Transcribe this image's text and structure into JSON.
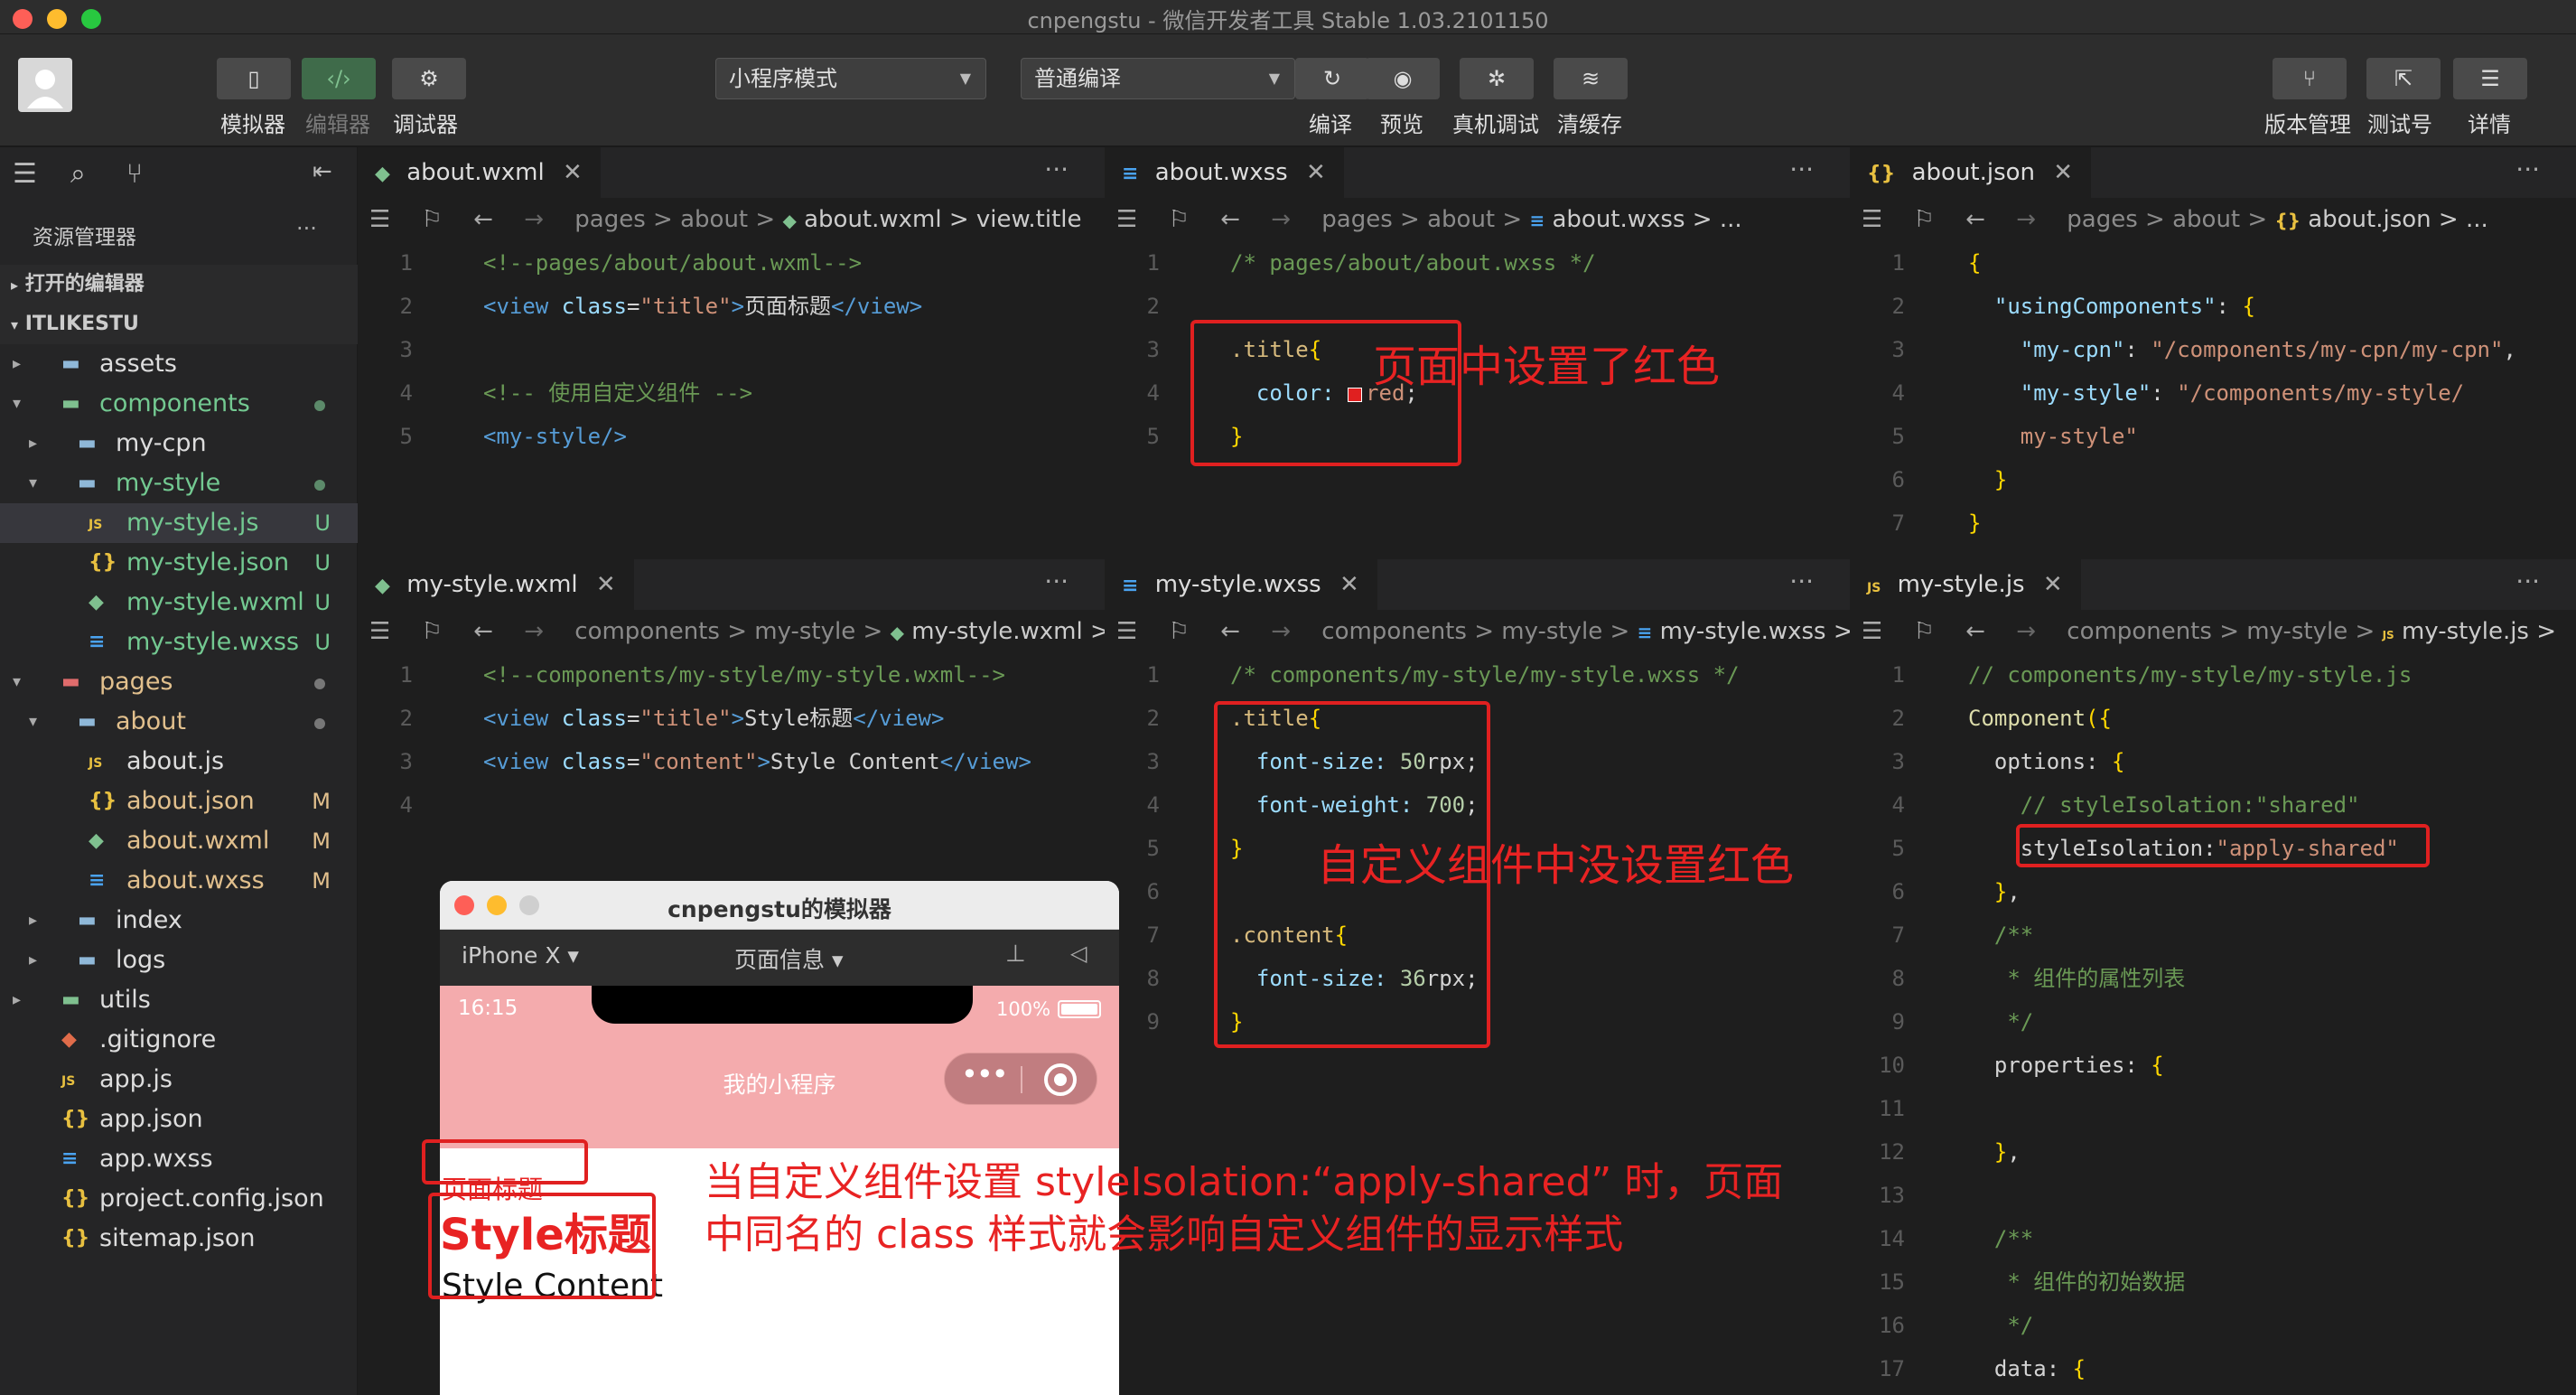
{
  "window": {
    "title": "cnpengstu - 微信开发者工具 Stable 1.03.2101150"
  },
  "toolbar": {
    "left": [
      {
        "label": "模拟器",
        "icon": "phone-icon"
      },
      {
        "label": "编辑器",
        "icon": "code-icon"
      },
      {
        "label": "调试器",
        "icon": "debug-icon"
      }
    ],
    "mode_select": "小程序模式",
    "compile_select": "普通编译",
    "center": [
      {
        "label": "编译",
        "icon": "refresh-icon"
      },
      {
        "label": "预览",
        "icon": "eye-icon"
      },
      {
        "label": "真机调试",
        "icon": "bug-icon"
      },
      {
        "label": "清缓存",
        "icon": "layers-icon"
      }
    ],
    "right": [
      {
        "label": "版本管理",
        "icon": "branch-icon"
      },
      {
        "label": "测试号",
        "icon": "share-icon"
      },
      {
        "label": "详情",
        "icon": "menu-icon"
      }
    ]
  },
  "sidebar": {
    "title": "资源管理器",
    "more": "···",
    "sections": [
      {
        "label": "打开的编辑器"
      },
      {
        "label": "ITLIKESTU"
      }
    ],
    "tree": [
      {
        "name": "assets",
        "type": "folder",
        "depth": 1,
        "arrow": "▸"
      },
      {
        "name": "components",
        "type": "folder-green",
        "depth": 1,
        "arrow": "▾",
        "dot": true,
        "color": "#73c991"
      },
      {
        "name": "my-cpn",
        "type": "folder",
        "depth": 2,
        "arrow": "▸"
      },
      {
        "name": "my-style",
        "type": "folder",
        "depth": 2,
        "arrow": "▾",
        "dot": true,
        "color": "#73c991"
      },
      {
        "name": "my-style.js",
        "type": "js",
        "depth": 3,
        "status": "U",
        "color": "#73c991",
        "selected": true
      },
      {
        "name": "my-style.json",
        "type": "json",
        "depth": 3,
        "status": "U",
        "color": "#73c991"
      },
      {
        "name": "my-style.wxml",
        "type": "wxml",
        "depth": 3,
        "status": "U",
        "color": "#73c991"
      },
      {
        "name": "my-style.wxss",
        "type": "wxss",
        "depth": 3,
        "status": "U",
        "color": "#73c991"
      },
      {
        "name": "pages",
        "type": "folder-red",
        "depth": 1,
        "arrow": "▾",
        "dot": true,
        "color": "#e2c08d"
      },
      {
        "name": "about",
        "type": "folder",
        "depth": 2,
        "arrow": "▾",
        "dot": true,
        "color": "#e2c08d"
      },
      {
        "name": "about.js",
        "type": "js",
        "depth": 3
      },
      {
        "name": "about.json",
        "type": "json",
        "depth": 3,
        "status": "M",
        "color": "#e2c08d"
      },
      {
        "name": "about.wxml",
        "type": "wxml",
        "depth": 3,
        "status": "M",
        "color": "#e2c08d"
      },
      {
        "name": "about.wxss",
        "type": "wxss",
        "depth": 3,
        "status": "M",
        "color": "#e2c08d"
      },
      {
        "name": "index",
        "type": "folder",
        "depth": 2,
        "arrow": "▸"
      },
      {
        "name": "logs",
        "type": "folder",
        "depth": 2,
        "arrow": "▸"
      },
      {
        "name": "utils",
        "type": "folder-green",
        "depth": 1,
        "arrow": "▸"
      },
      {
        "name": ".gitignore",
        "type": "git",
        "depth": 1
      },
      {
        "name": "app.js",
        "type": "js",
        "depth": 1
      },
      {
        "name": "app.json",
        "type": "json",
        "depth": 1
      },
      {
        "name": "app.wxss",
        "type": "wxss",
        "depth": 1
      },
      {
        "name": "project.config.json",
        "type": "json",
        "depth": 1
      },
      {
        "name": "sitemap.json",
        "type": "json",
        "depth": 1
      }
    ]
  },
  "panes": [
    {
      "id": "about-wxml",
      "tab": "about.wxml",
      "crumbs": [
        "pages",
        ">",
        "about",
        ">"
      ],
      "crumb_file": "about.wxml",
      "crumb_tail": "> view.title",
      "lines": [
        [
          [
            "cm",
            "<!--pages/about/about.wxml-->"
          ]
        ],
        [
          [
            "tag",
            "<view "
          ],
          [
            "att",
            "class"
          ],
          [
            "punc",
            "="
          ],
          [
            "str",
            "\"title\""
          ],
          [
            "tag",
            ">"
          ],
          [
            "plain",
            "页面标题"
          ],
          [
            "tag",
            "</view>"
          ]
        ],
        [],
        [
          [
            "cm",
            "<!-- 使用自定义组件 -->"
          ]
        ],
        [
          [
            "tag",
            "<my-style/>"
          ]
        ]
      ]
    },
    {
      "id": "about-wxss",
      "tab": "about.wxss",
      "crumbs": [
        "pages",
        ">",
        "about",
        ">"
      ],
      "crumb_file": "about.wxss",
      "crumb_tail": "> ...",
      "lines": [
        [
          [
            "cm",
            "/* pages/about/about.wxss */"
          ]
        ],
        [],
        [
          [
            "sel2",
            ".title"
          ],
          [
            "yel",
            "{"
          ]
        ],
        [
          [
            "prop",
            "  color: "
          ],
          [
            "swatch",
            ""
          ],
          [
            "str",
            "red"
          ],
          [
            "punc",
            ";"
          ]
        ],
        [
          [
            "yel",
            "}"
          ]
        ]
      ]
    },
    {
      "id": "about-json",
      "tab": "about.json",
      "crumbs": [
        "pages",
        ">",
        "about",
        ">"
      ],
      "crumb_file": "about.json",
      "crumb_tail": "> ...",
      "lines": [
        [
          [
            "yel",
            "{"
          ]
        ],
        [
          [
            "att",
            "  \"usingComponents\""
          ],
          [
            "punc",
            ": "
          ],
          [
            "yel",
            "{"
          ]
        ],
        [
          [
            "att",
            "    \"my-cpn\""
          ],
          [
            "punc",
            ": "
          ],
          [
            "str",
            "\"/components/my-cpn/my-cpn\""
          ],
          [
            "punc",
            ","
          ]
        ],
        [
          [
            "att",
            "    \"my-style\""
          ],
          [
            "punc",
            ": "
          ],
          [
            "str",
            "\"/components/my-style/"
          ]
        ],
        [
          [
            "str",
            "    my-style\""
          ]
        ],
        [
          [
            "yel",
            "  }"
          ]
        ],
        [
          [
            "yel",
            "}"
          ]
        ]
      ]
    },
    {
      "id": "my-style-wxml",
      "tab": "my-style.wxml",
      "crumbs": [
        "components",
        ">",
        "my-style",
        ">"
      ],
      "crumb_file": "my-style.wxml",
      "crumb_tail": ">",
      "lines": [
        [
          [
            "cm",
            "<!--components/my-style/my-style.wxml-->"
          ]
        ],
        [
          [
            "tag",
            "<view "
          ],
          [
            "att",
            "class"
          ],
          [
            "punc",
            "="
          ],
          [
            "str",
            "\"title\""
          ],
          [
            "tag",
            ">"
          ],
          [
            "plain",
            "Style标题"
          ],
          [
            "tag",
            "</view>"
          ]
        ],
        [
          [
            "tag",
            "<view "
          ],
          [
            "att",
            "class"
          ],
          [
            "punc",
            "="
          ],
          [
            "str",
            "\"content\""
          ],
          [
            "tag",
            ">"
          ],
          [
            "plain",
            "Style Content"
          ],
          [
            "tag",
            "</view>"
          ]
        ],
        []
      ]
    },
    {
      "id": "my-style-wxss",
      "tab": "my-style.wxss",
      "crumbs": [
        "components",
        ">",
        "my-style",
        ">"
      ],
      "crumb_file": "my-style.wxss",
      "crumb_tail": ">",
      "lines": [
        [
          [
            "cm",
            "/* components/my-style/my-style.wxss */"
          ]
        ],
        [
          [
            "sel2",
            ".title"
          ],
          [
            "yel",
            "{"
          ]
        ],
        [
          [
            "prop",
            "  font-size: "
          ],
          [
            "val",
            "50"
          ],
          [
            "plain",
            "rpx"
          ],
          [
            "punc",
            ";"
          ]
        ],
        [
          [
            "prop",
            "  font-weight: "
          ],
          [
            "val",
            "700"
          ],
          [
            "punc",
            ";"
          ]
        ],
        [
          [
            "yel",
            "}"
          ]
        ],
        [],
        [
          [
            "sel2",
            ".content"
          ],
          [
            "yel",
            "{"
          ]
        ],
        [
          [
            "prop",
            "  font-size: "
          ],
          [
            "val",
            "36"
          ],
          [
            "plain",
            "rpx"
          ],
          [
            "punc",
            ";"
          ]
        ],
        [
          [
            "yel",
            "}"
          ]
        ]
      ]
    },
    {
      "id": "my-style-js",
      "tab": "my-style.js",
      "crumbs": [
        "components",
        ">",
        "my-style",
        ">"
      ],
      "crumb_file": "my-style.js",
      "crumb_tail": ">",
      "lines": [
        [
          [
            "cm",
            "// components/my-style/my-style.js"
          ]
        ],
        [
          [
            "kw",
            "Component"
          ],
          [
            "yel",
            "({"
          ]
        ],
        [
          [
            "plain",
            "  options: "
          ],
          [
            "yel",
            "{"
          ]
        ],
        [
          [
            "cm",
            "    // styleIsolation:\"shared\""
          ]
        ],
        [
          [
            "plain",
            "    styleIsolation:"
          ],
          [
            "str",
            "\"apply-shared\""
          ]
        ],
        [
          [
            "yel",
            "  }"
          ],
          [
            "punc",
            ","
          ]
        ],
        [
          [
            "cm",
            "  /**"
          ]
        ],
        [
          [
            "cm",
            "   * 组件的属性列表"
          ]
        ],
        [
          [
            "cm",
            "   */"
          ]
        ],
        [
          [
            "plain",
            "  properties: "
          ],
          [
            "yel",
            "{"
          ]
        ],
        [],
        [
          [
            "yel",
            "  }"
          ],
          [
            "punc",
            ","
          ]
        ],
        [],
        [
          [
            "cm",
            "  /**"
          ]
        ],
        [
          [
            "cm",
            "   * 组件的初始数据"
          ]
        ],
        [
          [
            "cm",
            "   */"
          ]
        ],
        [
          [
            "plain",
            "  data: "
          ],
          [
            "yel",
            "{"
          ]
        ]
      ]
    }
  ],
  "simulator": {
    "title": "cnpengstu的模拟器",
    "device": "iPhone X ▾",
    "page_info": "页面信息 ▾",
    "time": "16:15",
    "battery": "100%",
    "nav_title": "我的小程序",
    "capsule_dots": "•••",
    "page_title": "页面标题",
    "style_title": "Style标题",
    "style_content": "Style Content"
  },
  "annotations": {
    "page_red": "页面中设置了红色",
    "component_no_red": "自定义组件中没设置红色",
    "explain_line1": "当自定义组件设置 styleIsolation:“apply-shared” 时，页面",
    "explain_line2": "中同名的 class 样式就会影响自定义组件的显示样式"
  },
  "colors": {
    "annotation": "#e82323",
    "sim_nav": "#f4abad",
    "accent_green": "#73c991",
    "modified": "#e2c08d"
  }
}
